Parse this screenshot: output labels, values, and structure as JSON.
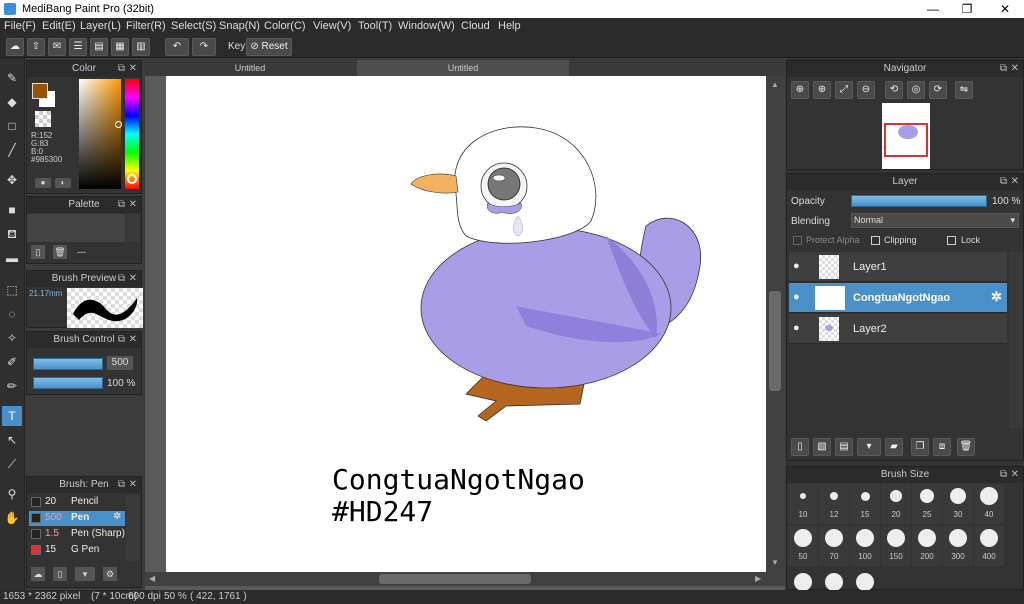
{
  "app": {
    "title": "MediBang Paint Pro (32bit)"
  },
  "menu": [
    "File(F)",
    "Edit(E)",
    "Layer(L)",
    "Filter(R)",
    "Select(S)",
    "Snap(N)",
    "Color(C)",
    "View(V)",
    "Tool(T)",
    "Window(W)",
    "Cloud",
    "Help"
  ],
  "toolbar": {
    "key_label": "Key",
    "reset_label": "Reset"
  },
  "tabs": [
    "Untitled",
    "Untitled"
  ],
  "color_panel": {
    "title": "Color",
    "r": "R:152",
    "g": "G:83",
    "b": "B:0",
    "hex": "#985300",
    "fg_color": "#985300"
  },
  "palette_panel": {
    "title": "Palette",
    "empty": "---"
  },
  "brush_preview": {
    "title": "Brush Preview",
    "size": "21.17mm"
  },
  "brush_control": {
    "title": "Brush Control",
    "size_value": "500",
    "opacity_value": "100 %"
  },
  "brush_panel": {
    "title": "Brush: Pen",
    "items": [
      {
        "size": "20",
        "name": "Pencil",
        "color": "#222222"
      },
      {
        "size": "500",
        "name": "Pen",
        "color": "#222222"
      },
      {
        "size": "1.5",
        "name": "Pen (Sharp)",
        "color": "#222222"
      },
      {
        "size": "15",
        "name": "G Pen",
        "color": "#e03030"
      }
    ]
  },
  "canvas": {
    "text_line1": "CongtuaNgotNgao",
    "text_line2": "#HD247"
  },
  "navigator": {
    "title": "Navigator"
  },
  "layer_panel": {
    "title": "Layer",
    "opacity_label": "Opacity",
    "opacity_value": "100 %",
    "blending_label": "Blending",
    "blending_value": "Normal",
    "protect_alpha": "Protect Alpha",
    "clipping": "Clipping",
    "lock": "Lock",
    "layers": [
      {
        "name": "Layer1"
      },
      {
        "name": "CongtuaNgotNgao"
      },
      {
        "name": "Layer2"
      }
    ]
  },
  "brush_size": {
    "title": "Brush Size",
    "sizes": [
      "10",
      "12",
      "15",
      "20",
      "25",
      "30",
      "40",
      "50",
      "70",
      "100",
      "150",
      "200",
      "300",
      "400"
    ]
  },
  "status": {
    "dims": "1653 * 2362 pixel",
    "cm": "(7 * 10cm)",
    "dpi": "600 dpi",
    "zoom": "50 %",
    "coords": "( 422, 1761 )"
  }
}
